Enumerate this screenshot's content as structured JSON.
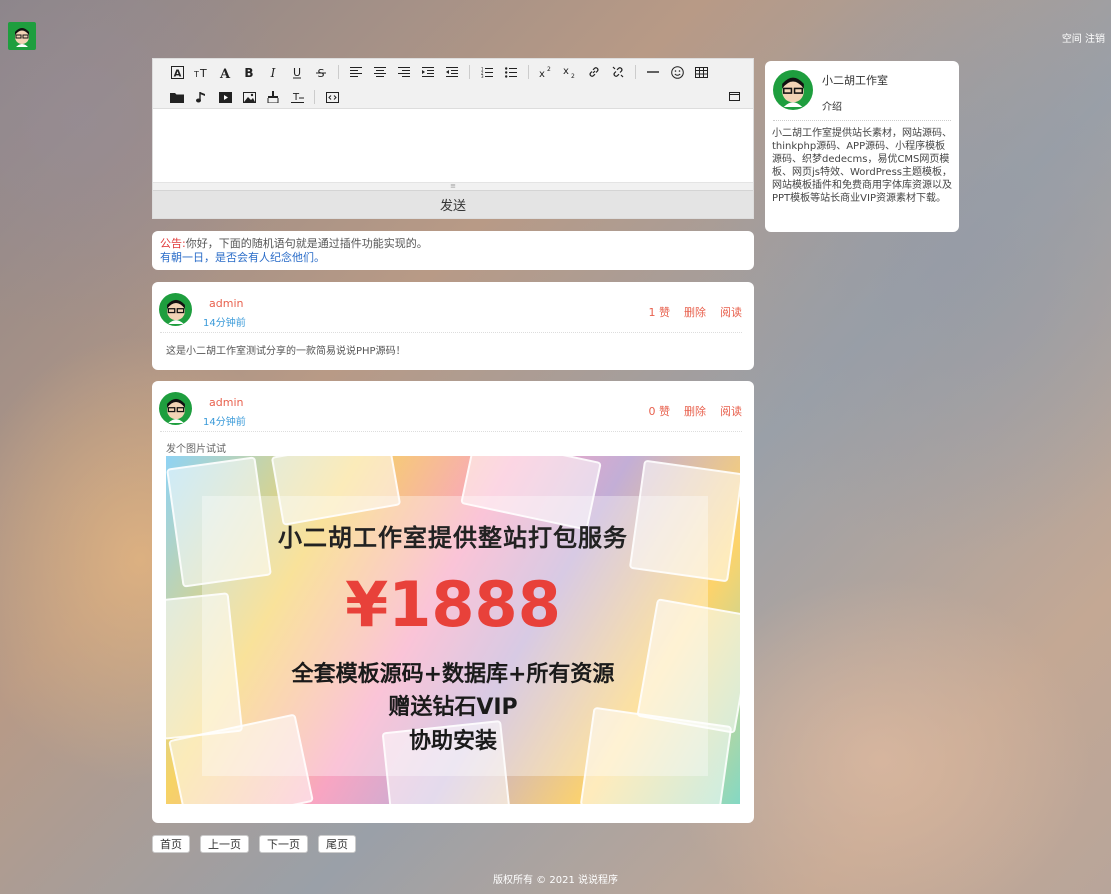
{
  "header": {
    "logo_icon": "avatar-icon",
    "link_space": "空间",
    "link_logout": "注销"
  },
  "editor": {
    "toolbar_row1": [
      "font-family-icon",
      "font-size-icon",
      "font-color-icon",
      "bold-icon",
      "italic-icon",
      "underline-icon",
      "strikethrough-icon",
      "align-left-icon",
      "align-center-icon",
      "align-right-icon",
      "indent-icon",
      "outdent-icon",
      "ordered-list-icon",
      "unordered-list-icon",
      "superscript-icon",
      "subscript-icon",
      "link-icon",
      "unlink-icon",
      "horizontal-rule-icon",
      "emoji-icon",
      "table-icon"
    ],
    "toolbar_row2": [
      "folder-icon",
      "music-icon",
      "video-icon",
      "image-icon",
      "paint-icon",
      "clear-format-icon",
      "source-code-icon"
    ],
    "fullscreen_icon": "fullscreen-icon",
    "send_label": "发送"
  },
  "notice": {
    "label": "公告:",
    "text": "你好，下面的随机语句就是通过插件功能实现的。",
    "quote": "有朝一日，是否会有人纪念他们。"
  },
  "posts": [
    {
      "author": "admin",
      "time": "14分钟前",
      "likes": "1 赞",
      "delete": "删除",
      "read": "阅读",
      "content": "这是小二胡工作室测试分享的一款简易说说PHP源码！"
    },
    {
      "author": "admin",
      "time": "14分钟前",
      "likes": "0 赞",
      "delete": "删除",
      "read": "阅读",
      "content": "发个图片试试",
      "image": {
        "title": "小二胡工作室提供整站打包服务",
        "price": "¥1888",
        "line1": "全套模板源码+数据库+所有资源",
        "line2": "赠送钻石VIP",
        "line3": "协助安装"
      }
    }
  ],
  "pager": {
    "first": "首页",
    "prev": "上一页",
    "next": "下一页",
    "last": "尾页"
  },
  "footer": {
    "text": "版权所有 © 2021 说说程序"
  },
  "profile": {
    "name": "小二胡工作室",
    "intro_label": "介绍",
    "description": "小二胡工作室提供站长素材，网站源码、thinkphp源码、APP源码、小程序模板源码、织梦dedecms，易优CMS网页模板、网页js特效、WordPress主题模板，网站模板插件和免费商用字体库资源以及PPT模板等站长商业VIP资源素材下载。"
  },
  "colors": {
    "accent_red": "#e8614e",
    "link_blue": "#3a9ad9",
    "avatar_green": "#1e9e3e",
    "price_red": "#e8413a"
  }
}
